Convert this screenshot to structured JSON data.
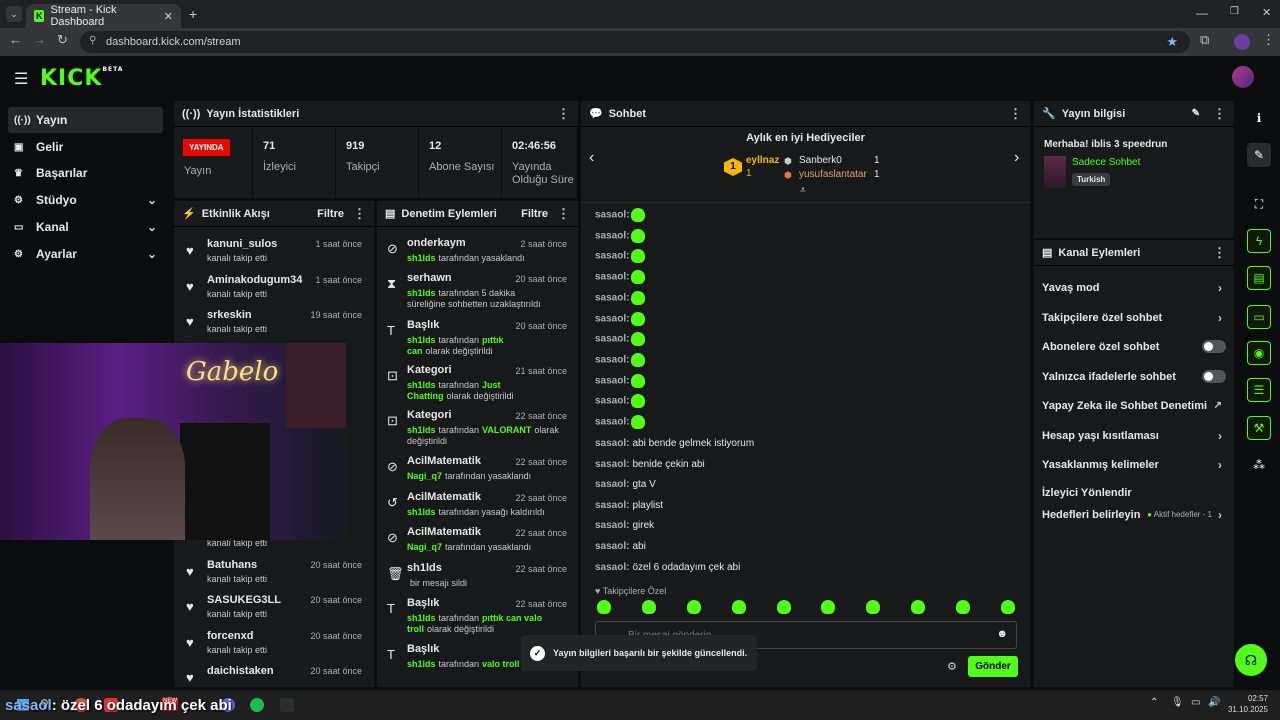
{
  "browser": {
    "tab_title": "Stream - Kick Dashboard",
    "url": "dashboard.kick.com/stream"
  },
  "brand": {
    "logo": "KICK",
    "beta": "BETA",
    "accent": "#53fc18"
  },
  "nav": [
    {
      "label": "Yayın",
      "icon": "broadcast-icon"
    },
    {
      "label": "Gelir",
      "icon": "wallet-icon"
    },
    {
      "label": "Başarılar",
      "icon": "trophy-icon"
    },
    {
      "label": "Stüdyo",
      "icon": "gear-icon"
    },
    {
      "label": "Kanal",
      "icon": "tv-icon"
    },
    {
      "label": "Ayarlar",
      "icon": "settings-icon"
    }
  ],
  "stats": {
    "title": "Yayın İstatistikleri",
    "live": "YAYINDA",
    "status_label": "Yayın",
    "items": [
      {
        "value": "71",
        "label": "İzleyici"
      },
      {
        "value": "919",
        "label": "Takipçi"
      },
      {
        "value": "12",
        "label": "Abone Sayısı"
      },
      {
        "value": "02:46:56",
        "label": "Yayında Olduğu Süre"
      }
    ]
  },
  "activity": {
    "title": "Etkinlik Akışı",
    "filter": "Filtre",
    "items": [
      {
        "name": "kanuni_sulos",
        "sub": "kanalı takip etti",
        "time": "1 saat önce"
      },
      {
        "name": "Aminakodugum34",
        "sub": "kanalı takip etti",
        "time": "1 saat önce"
      },
      {
        "name": "srkeskin",
        "sub": "kanalı takip etti",
        "time": "19 saat önce"
      },
      {
        "name": "Batuhans",
        "sub": "kanalı takip etti",
        "time": "20 saat önce"
      },
      {
        "name": "SASUKEG3LL",
        "sub": "kanalı takip etti",
        "time": "20 saat önce"
      },
      {
        "name": "forcenxd",
        "sub": "kanalı takip etti",
        "time": "20 saat önce"
      },
      {
        "name": "daichistaken",
        "sub": "",
        "time": "20 saat önce"
      }
    ],
    "partial_sub": "kanalı takip etti"
  },
  "moderation": {
    "title": "Denetim Eylemleri",
    "filter": "Filtre",
    "items": [
      {
        "name": "onderkaym",
        "by": "sh1lds",
        "text": "tarafından yasaklandı",
        "time": "2 saat önce",
        "icon": "ban-icon"
      },
      {
        "name": "serhawn",
        "by": "sh1lds",
        "text": "tarafından 5 dakika süreliğine sohbetten uzaklaştırıldı",
        "time": "20 saat önce",
        "icon": "hourglass-icon"
      },
      {
        "name": "Başlık",
        "by": "sh1lds",
        "text": "tarafından",
        "hl": "pıttık can",
        "text2": "olarak değiştirildi",
        "time": "20 saat önce",
        "icon": "title-icon"
      },
      {
        "name": "Kategori",
        "by": "sh1lds",
        "text": "tarafından",
        "hl": "Just Chatting",
        "text2": "olarak değiştirildi",
        "time": "21 saat önce",
        "icon": "category-icon"
      },
      {
        "name": "Kategori",
        "by": "sh1lds",
        "text": "tarafından",
        "hl": "VALORANT",
        "text2": "olarak değiştirildi",
        "time": "22 saat önce",
        "icon": "category-icon"
      },
      {
        "name": "AcilMatematik",
        "by": "Nagi_q7",
        "text": "tarafından yasaklandı",
        "time": "22 saat önce",
        "icon": "ban-icon"
      },
      {
        "name": "AcilMatematik",
        "by": "sh1lds",
        "text": "tarafından yasağı kaldırıldı",
        "time": "22 saat önce",
        "icon": "undo-icon"
      },
      {
        "name": "AcilMatematik",
        "by": "Nagi_q7",
        "text": "tarafından yasaklandı",
        "time": "22 saat önce",
        "icon": "ban-icon"
      },
      {
        "name": "sh1lds",
        "by": "",
        "text": "bir mesajı sildi",
        "time": "22 saat önce",
        "icon": "trash-icon"
      },
      {
        "name": "Başlık",
        "by": "sh1lds",
        "text": "tarafından",
        "hl": "pıttık can valo troll",
        "text2": "olarak değiştirildi",
        "time": "22 saat önce",
        "icon": "title-icon"
      },
      {
        "name": "Başlık",
        "by": "sh1lds",
        "text": "tarafından",
        "hl": "valo troll",
        "text2": "ola",
        "time": "",
        "icon": "title-icon"
      }
    ]
  },
  "chat": {
    "title": "Sohbet",
    "gifters_title": "Aylık en iyi Hediyeciler",
    "gifters": [
      {
        "name": "eyllnaz",
        "count": "1",
        "rank": "1"
      },
      {
        "name": "Sanberk0",
        "count": "1"
      },
      {
        "name": "yusufaslantatar",
        "count": "1"
      }
    ],
    "emote_user": "sasaol:",
    "emote_lines": 11,
    "messages": [
      {
        "user": "sasaol:",
        "text": "abi bende gelmek istiyorum"
      },
      {
        "user": "sasaol:",
        "text": "benide çekin abi"
      },
      {
        "user": "sasaol:",
        "text": "gta V"
      },
      {
        "user": "sasaol:",
        "text": "playlist"
      },
      {
        "user": "sasaol:",
        "text": "girek"
      },
      {
        "user": "sasaol:",
        "text": "abi"
      },
      {
        "user": "sasaol:",
        "text": "özel 6 odadayım çek abi"
      }
    ],
    "followers_only": "Takipçilere Özel",
    "input_placeholder": "Bir mesaj gönderin",
    "send": "Gönder"
  },
  "toast": {
    "text": "Yayın bilgileri başarılı bir şekilde güncellendi."
  },
  "stream_info": {
    "title": "Yayın bilgisi",
    "stream_title": "Merhaba! iblis 3 speedrun",
    "mode": "Sadece Sohbet",
    "language": "Turkish"
  },
  "channel_actions": {
    "title": "Kanal Eylemleri",
    "items": [
      {
        "label": "Yavaş mod",
        "kind": "arrow"
      },
      {
        "label": "Takipçilere özel sohbet",
        "kind": "arrow"
      },
      {
        "label": "Abonelere özel sohbet",
        "kind": "toggle"
      },
      {
        "label": "Yalnızca ifadelerle sohbet",
        "kind": "toggle"
      },
      {
        "label": "Yapay Zeka ile Sohbet Denetimi",
        "kind": "external"
      },
      {
        "label": "Hesap yaşı kısıtlaması",
        "kind": "arrow"
      },
      {
        "label": "Yasaklanmış kelimeler",
        "kind": "arrow"
      },
      {
        "label": "İzleyici Yönlendir",
        "kind": "none"
      },
      {
        "label": "Hedefleri belirleyin",
        "kind": "goal",
        "extra": "Aktif hedefler - 1"
      }
    ]
  },
  "overlay_caption": {
    "user": "sasaol",
    "text": ": özel 6 odadayım çek abi"
  },
  "webcam_sign": "Gabelo",
  "taskbar": {
    "time": "02:57",
    "date": "31.10.2025"
  }
}
